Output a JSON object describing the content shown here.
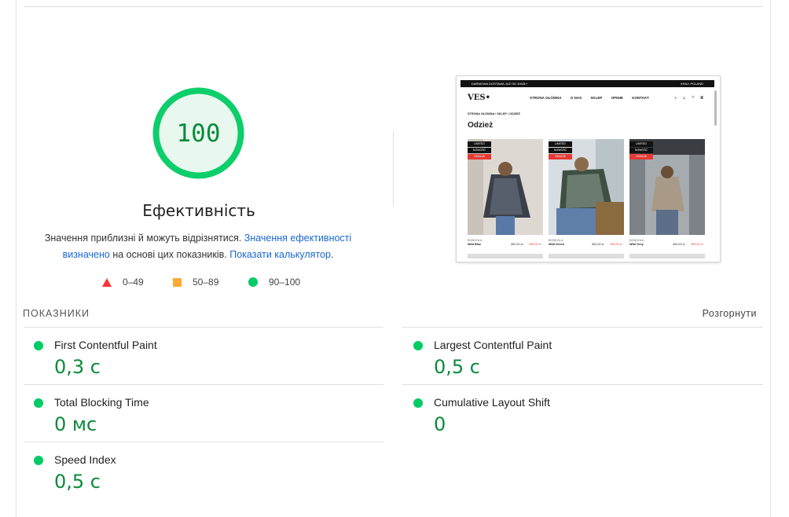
{
  "gauge": {
    "score": "100",
    "score_fraction": 1.0,
    "title": "Ефективність",
    "desc_part1": "Значення приблизні й можуть відрізнятися.",
    "desc_link1": "Значення ефективності визначено",
    "desc_part2": "на основі цих показників.",
    "desc_link2": "Показати калькулятор",
    "desc_end": ".",
    "color": "#0cce6b"
  },
  "legend": [
    {
      "shape": "triangle",
      "label": "0–49",
      "color": "#ff3333"
    },
    {
      "shape": "square",
      "label": "50–89",
      "color": "#ffaa33"
    },
    {
      "shape": "circle",
      "label": "90–100",
      "color": "#00cc66"
    }
  ],
  "preview": {
    "topbar_left": "DARMOWA DOSTAWA JUŻ OD 300ZŁ*",
    "topbar_right": "KRAJ: POLAND",
    "logo": "VES•",
    "nav": [
      "STRONA GŁÓWNA",
      "O NAS",
      "SKLEP",
      "OPINIE",
      "KONTAKT"
    ],
    "icons": "⌕ ♙ ♡ ▣",
    "breadcrumb": "STRONA GŁÓWNA / SKLEP / ODZIEŻ",
    "heading": "Odzież",
    "tags": [
      "LIMITED",
      "NOWOŚĆ",
      "OKAZJA"
    ],
    "products": [
      {
        "brand": "BONDOLA",
        "name": "Wild Blue",
        "price": "400,00 zł",
        "sale": "399,00 zł"
      },
      {
        "brand": "BONDOLA",
        "name": "Wild Green",
        "price": "400,00 zł",
        "sale": "399,00 zł"
      },
      {
        "brand": "BONDOLA",
        "name": "Wild Grey",
        "price": "400,00 zł",
        "sale": "399,00 zł"
      }
    ]
  },
  "metrics": {
    "header": "ПОКАЗНИКИ",
    "expand_label": "Розгорнути",
    "items": [
      {
        "title": "First Contentful Paint",
        "value": "0,3 с"
      },
      {
        "title": "Largest Contentful Paint",
        "value": "0,5 с"
      },
      {
        "title": "Total Blocking Time",
        "value": "0 мс"
      },
      {
        "title": "Cumulative Layout Shift",
        "value": "0"
      },
      {
        "title": "Speed Index",
        "value": "0,5 с"
      }
    ]
  }
}
